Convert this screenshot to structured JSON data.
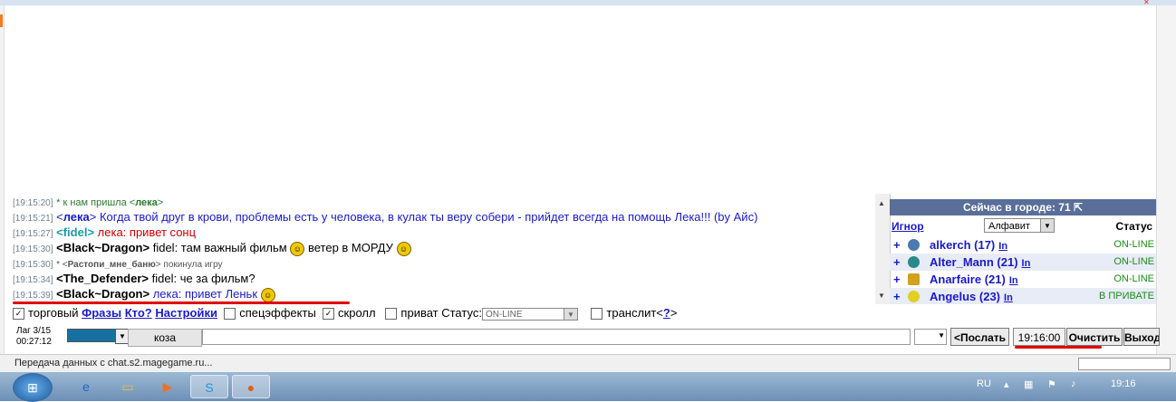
{
  "chat": {
    "lines": [
      {
        "time": "[19:15:20]",
        "pre": "* к нам пришла <",
        "nick": "лека",
        "post": ">"
      },
      {
        "time": "[19:15:21]",
        "nick": "лека",
        "text": "Когда твой друг в крови, проблемы есть у человека, в кулак ты веру собери - прийдет всегда на помощь Лека!!! (by Айс)"
      },
      {
        "time": "[19:15:27]",
        "nick": "fidel",
        "text": "лека: привет сонц"
      },
      {
        "time": "[19:15:30]",
        "nick": "Black~Dragon",
        "text": "fidel: там важный фильм",
        "text2": "ветер в МОРДУ"
      },
      {
        "time": "[19:15:30]",
        "pre": "* <",
        "nick": "Растопи_мне_баню",
        "post": "> покинула игру"
      },
      {
        "time": "[19:15:34]",
        "nick": "The_Defender",
        "text": "fidel: че за фильм?"
      },
      {
        "time": "[19:15:39]",
        "nick": "Black~Dragon",
        "text": "лека: привет Леньк"
      }
    ]
  },
  "users": {
    "header": "Сейчас в городе: 71",
    "ignore_label": "Игнор",
    "sort_value": "Алфавит",
    "status_label": "Статус",
    "list": [
      {
        "name": "alkerch (17)",
        "in": "In",
        "status": "ON-LINE"
      },
      {
        "name": "Alter_Mann (21)",
        "in": "In",
        "status": "ON-LINE"
      },
      {
        "name": "Anarfaire (21)",
        "in": "In",
        "status": "ON-LINE"
      },
      {
        "name": "Angelus (23)",
        "in": "In",
        "status": "В ПРИВАТЕ"
      }
    ]
  },
  "controls": {
    "trade": "торговый",
    "phrases": "Фразы",
    "who": "Кто?",
    "settings": "Настройки",
    "effects": "спецэффекты",
    "scroll": "скролл",
    "private": "приват Статус:",
    "status_value": "ON-LINE",
    "translit": "транслит<",
    "help": "?",
    "close_bracket": ">"
  },
  "input": {
    "lag": "Лаг 3/15",
    "timer": "00:27:12",
    "nick": "коза",
    "send": "<Послать",
    "clock": "19:16:00",
    "clear": "Очистить",
    "exit": "Выход"
  },
  "statusbar": {
    "text": "Передача данных с chat.s2.magegame.ru..."
  },
  "taskbar": {
    "lang": "RU",
    "time": "19:16"
  },
  "colors": {
    "header_bg": "#596e98",
    "link": "#1a1ac8",
    "online": "#1a8a1a",
    "underline": "#e00000"
  }
}
